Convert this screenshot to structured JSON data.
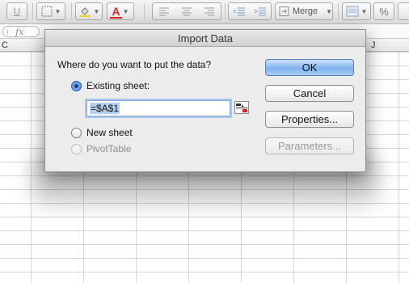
{
  "toolbar": {
    "underline_label": "U",
    "merge_label": "Merge",
    "percent_label": "%",
    "font_color_label": "A"
  },
  "formula_bar": {
    "fx_label": "fx"
  },
  "columns": [
    "C",
    "J"
  ],
  "dialog": {
    "title": "Import Data",
    "question": "Where do you want to put the data?",
    "options": [
      {
        "label": "Existing sheet:",
        "checked": true,
        "enabled": true
      },
      {
        "label": "New sheet",
        "checked": false,
        "enabled": true
      },
      {
        "label": "PivotTable",
        "checked": false,
        "enabled": false
      }
    ],
    "cell_reference": "=$A$1",
    "buttons": {
      "ok": "OK",
      "cancel": "Cancel",
      "properties": "Properties...",
      "parameters": "Parameters..."
    }
  },
  "colors": {
    "default_button": "#7fb3ef",
    "selection": "#b3d1f5",
    "dialog_bg": "#ececec"
  }
}
